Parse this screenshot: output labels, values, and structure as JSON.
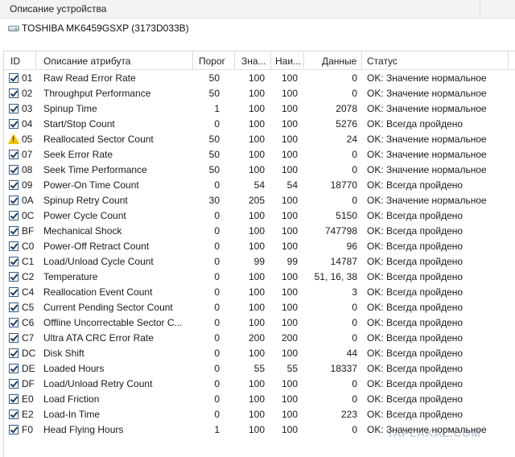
{
  "section": {
    "title": "Описание устройства"
  },
  "device": {
    "name": "TOSHIBA MK6459GSXP (3173D033B)",
    "icon": "hard-drive-icon"
  },
  "columns": [
    "ID",
    "Описание атрибута",
    "Порог",
    "Зна...",
    "Наи...",
    "Данные",
    "Статус"
  ],
  "rows": [
    {
      "id": "01",
      "name": "Raw Read Error Rate",
      "threshold": "50",
      "value": "100",
      "worst": "100",
      "data": "0",
      "status": "OK: Значение нормальное",
      "icon": "check"
    },
    {
      "id": "02",
      "name": "Throughput Performance",
      "threshold": "50",
      "value": "100",
      "worst": "100",
      "data": "0",
      "status": "OK: Значение нормальное",
      "icon": "check"
    },
    {
      "id": "03",
      "name": "Spinup Time",
      "threshold": "1",
      "value": "100",
      "worst": "100",
      "data": "2078",
      "status": "OK: Значение нормальное",
      "icon": "check"
    },
    {
      "id": "04",
      "name": "Start/Stop Count",
      "threshold": "0",
      "value": "100",
      "worst": "100",
      "data": "5276",
      "status": "OK: Всегда пройдено",
      "icon": "check"
    },
    {
      "id": "05",
      "name": "Reallocated Sector Count",
      "threshold": "50",
      "value": "100",
      "worst": "100",
      "data": "24",
      "status": "OK: Значение нормальное",
      "icon": "warning"
    },
    {
      "id": "07",
      "name": "Seek Error Rate",
      "threshold": "50",
      "value": "100",
      "worst": "100",
      "data": "0",
      "status": "OK: Значение нормальное",
      "icon": "check"
    },
    {
      "id": "08",
      "name": "Seek Time Performance",
      "threshold": "50",
      "value": "100",
      "worst": "100",
      "data": "0",
      "status": "OK: Значение нормальное",
      "icon": "check"
    },
    {
      "id": "09",
      "name": "Power-On Time Count",
      "threshold": "0",
      "value": "54",
      "worst": "54",
      "data": "18770",
      "status": "OK: Всегда пройдено",
      "icon": "check"
    },
    {
      "id": "0A",
      "name": "Spinup Retry Count",
      "threshold": "30",
      "value": "205",
      "worst": "100",
      "data": "0",
      "status": "OK: Значение нормальное",
      "icon": "check"
    },
    {
      "id": "0C",
      "name": "Power Cycle Count",
      "threshold": "0",
      "value": "100",
      "worst": "100",
      "data": "5150",
      "status": "OK: Всегда пройдено",
      "icon": "check"
    },
    {
      "id": "BF",
      "name": "Mechanical Shock",
      "threshold": "0",
      "value": "100",
      "worst": "100",
      "data": "747798",
      "status": "OK: Всегда пройдено",
      "icon": "check"
    },
    {
      "id": "C0",
      "name": "Power-Off Retract Count",
      "threshold": "0",
      "value": "100",
      "worst": "100",
      "data": "96",
      "status": "OK: Всегда пройдено",
      "icon": "check"
    },
    {
      "id": "C1",
      "name": "Load/Unload Cycle Count",
      "threshold": "0",
      "value": "99",
      "worst": "99",
      "data": "14787",
      "status": "OK: Всегда пройдено",
      "icon": "check"
    },
    {
      "id": "C2",
      "name": "Temperature",
      "threshold": "0",
      "value": "100",
      "worst": "100",
      "data": "51, 16, 38",
      "status": "OK: Всегда пройдено",
      "icon": "check"
    },
    {
      "id": "C4",
      "name": "Reallocation Event Count",
      "threshold": "0",
      "value": "100",
      "worst": "100",
      "data": "3",
      "status": "OK: Всегда пройдено",
      "icon": "check"
    },
    {
      "id": "C5",
      "name": "Current Pending Sector Count",
      "threshold": "0",
      "value": "100",
      "worst": "100",
      "data": "0",
      "status": "OK: Всегда пройдено",
      "icon": "check"
    },
    {
      "id": "C6",
      "name": "Offline Uncorrectable Sector C...",
      "threshold": "0",
      "value": "100",
      "worst": "100",
      "data": "0",
      "status": "OK: Всегда пройдено",
      "icon": "check"
    },
    {
      "id": "C7",
      "name": "Ultra ATA CRC Error Rate",
      "threshold": "0",
      "value": "200",
      "worst": "200",
      "data": "0",
      "status": "OK: Всегда пройдено",
      "icon": "check"
    },
    {
      "id": "DC",
      "name": "Disk Shift",
      "threshold": "0",
      "value": "100",
      "worst": "100",
      "data": "44",
      "status": "OK: Всегда пройдено",
      "icon": "check"
    },
    {
      "id": "DE",
      "name": "Loaded Hours",
      "threshold": "0",
      "value": "55",
      "worst": "55",
      "data": "18337",
      "status": "OK: Всегда пройдено",
      "icon": "check"
    },
    {
      "id": "DF",
      "name": "Load/Unload Retry Count",
      "threshold": "0",
      "value": "100",
      "worst": "100",
      "data": "0",
      "status": "OK: Всегда пройдено",
      "icon": "check"
    },
    {
      "id": "E0",
      "name": "Load Friction",
      "threshold": "0",
      "value": "100",
      "worst": "100",
      "data": "0",
      "status": "OK: Всегда пройдено",
      "icon": "check"
    },
    {
      "id": "E2",
      "name": "Load-In Time",
      "threshold": "0",
      "value": "100",
      "worst": "100",
      "data": "223",
      "status": "OK: Всегда пройдено",
      "icon": "check"
    },
    {
      "id": "F0",
      "name": "Head Flying Hours",
      "threshold": "1",
      "value": "100",
      "worst": "100",
      "data": "0",
      "status": "OK: Значение нормальное",
      "icon": "check"
    }
  ],
  "watermark": "YAPLAKAL.COM"
}
